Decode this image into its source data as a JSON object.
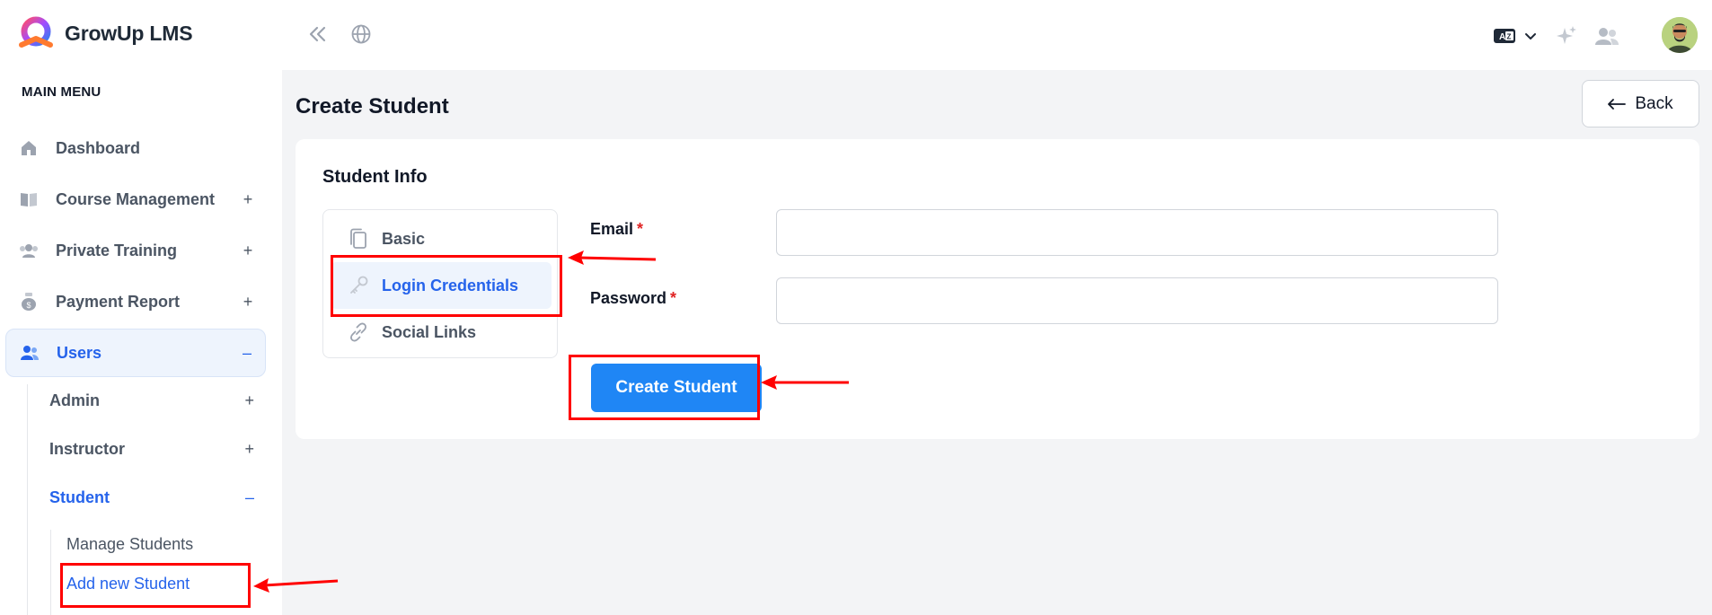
{
  "app": {
    "name": "GrowUp LMS"
  },
  "sidebar": {
    "heading": "MAIN MENU",
    "items": [
      {
        "label": "Dashboard",
        "icon": "home-icon",
        "toggle": ""
      },
      {
        "label": "Course Management",
        "icon": "book-icon",
        "toggle": "+"
      },
      {
        "label": "Private Training",
        "icon": "team-icon",
        "toggle": "+"
      },
      {
        "label": "Payment Report",
        "icon": "money-bag-icon",
        "toggle": "+"
      },
      {
        "label": "Users",
        "icon": "users-icon",
        "toggle": "–"
      }
    ],
    "users_sub": [
      {
        "label": "Admin",
        "toggle": "+"
      },
      {
        "label": "Instructor",
        "toggle": "+"
      },
      {
        "label": "Student",
        "toggle": "–"
      }
    ],
    "student_sub": [
      {
        "label": "Manage Students"
      },
      {
        "label": "Add new Student"
      }
    ]
  },
  "topbar": {
    "icons": [
      "collapse-sidebar-icon",
      "globe-icon",
      "language-icon",
      "sparkle-icon",
      "user-switch-icon",
      "avatar"
    ]
  },
  "page": {
    "title": "Create Student",
    "back_label": "Back"
  },
  "card": {
    "title": "Student Info",
    "tabs": [
      {
        "label": "Basic",
        "icon": "copy-icon"
      },
      {
        "label": "Login Credentials",
        "icon": "key-icon"
      },
      {
        "label": "Social Links",
        "icon": "link-icon"
      }
    ],
    "fields": {
      "email": {
        "label": "Email",
        "required": "*",
        "value": "",
        "placeholder": ""
      },
      "password": {
        "label": "Password",
        "required": "*",
        "value": "",
        "placeholder": ""
      }
    },
    "submit_label": "Create Student"
  },
  "colors": {
    "accent": "#2563eb",
    "button": "#1f86f5",
    "annotation": "#ff0000"
  }
}
